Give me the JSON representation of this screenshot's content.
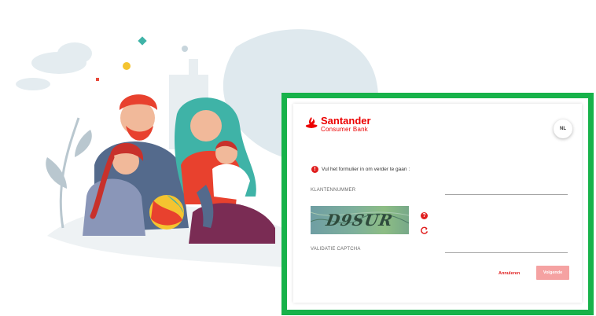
{
  "brand": {
    "name": "Santander",
    "subname": "Consumer Bank",
    "color": "#ec0000"
  },
  "language_button": {
    "label": "NL"
  },
  "form": {
    "instruction": "Vul het formulier in om verder te gaan :",
    "customer_number_label": "KLANTENNUMMER",
    "customer_number_value": "",
    "captcha_text": "D9SUR",
    "captcha_label": "VALIDATIE CAPTCHA",
    "captcha_value": "",
    "help_icon": "question-icon",
    "refresh_icon": "refresh-icon"
  },
  "actions": {
    "cancel_label": "Annuleren",
    "next_label": "Volgende"
  },
  "colors": {
    "highlight": "#17b24a",
    "accent": "#e01e1e",
    "button_disabled": "#f5a2a2"
  }
}
